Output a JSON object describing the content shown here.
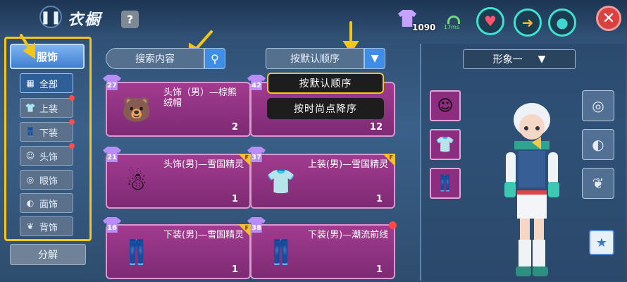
{
  "header": {
    "title": "衣橱",
    "help": "?",
    "currency": "1090",
    "ping": "17ms",
    "close": "✕"
  },
  "sidebar": {
    "category": "服饰",
    "items": [
      {
        "label": "全部",
        "icon": "grid-icon",
        "active": true,
        "dot": false
      },
      {
        "label": "上装",
        "icon": "shirt-icon",
        "active": false,
        "dot": true
      },
      {
        "label": "下装",
        "icon": "pants-icon",
        "active": false,
        "dot": true
      },
      {
        "label": "头饰",
        "icon": "head-icon",
        "active": false,
        "dot": true
      },
      {
        "label": "眼饰",
        "icon": "glasses-icon",
        "active": false,
        "dot": false
      },
      {
        "label": "面饰",
        "icon": "mask-icon",
        "active": false,
        "dot": false
      },
      {
        "label": "背饰",
        "icon": "wings-icon",
        "active": false,
        "dot": false
      }
    ],
    "decompose": "分解"
  },
  "search": {
    "placeholder": "搜索内容"
  },
  "sort": {
    "selected": "按默认顺序",
    "options": [
      "按默认顺序",
      "按时尚点降序"
    ]
  },
  "cards": [
    {
      "level": "27",
      "name": "头饰（男）—棕熊绒帽",
      "qty": "2",
      "badge": false,
      "dot": false
    },
    {
      "level": "42",
      "name": "",
      "qty": "12",
      "badge": false,
      "dot": false
    },
    {
      "level": "21",
      "name": "头饰(男)—雪国精灵",
      "qty": "1",
      "badge": true,
      "dot": false
    },
    {
      "level": "37",
      "name": "上装(男)—雪国精灵",
      "qty": "1",
      "badge": true,
      "dot": false
    },
    {
      "level": "16",
      "name": "下装(男)—雪国精灵",
      "qty": "1",
      "badge": true,
      "dot": false
    },
    {
      "level": "38",
      "name": "下装(男)—潮流前线",
      "qty": "1",
      "badge": false,
      "dot": true
    }
  ],
  "preview": {
    "look": "形象一"
  },
  "colors": {
    "highlight": "#f5c518",
    "card": "#a23b8f",
    "accent": "#3e8ee8"
  }
}
